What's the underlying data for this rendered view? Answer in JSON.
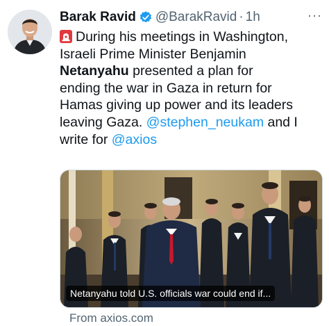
{
  "author": {
    "display_name": "Barak Ravid",
    "handle": "@BarakRavid",
    "separator": "·",
    "time": "1h",
    "verified": true,
    "more_label": "···"
  },
  "tweet": {
    "emoji": "siren-icon",
    "line1": "During his meetings in Washington,",
    "line2": "Israeli Prime Minister Benjamin",
    "line3_bold": "Netanyahu",
    "line3_rest": " presented a plan for",
    "line4": "ending the war in Gaza in return for",
    "line5": "Hamas giving up power and its leaders",
    "line6_text": "leaving Gaza. ",
    "line6_mention": "@stephen_neukam",
    "line6_tail": " and I",
    "line7_text": "write for ",
    "line7_mention": "@axios"
  },
  "card": {
    "caption": "Netanyahu told U.S. officials war could end if...",
    "source": "From axios.com"
  },
  "colors": {
    "accent": "#1d9bf0",
    "text": "#0f1419",
    "secondary": "#536471"
  }
}
